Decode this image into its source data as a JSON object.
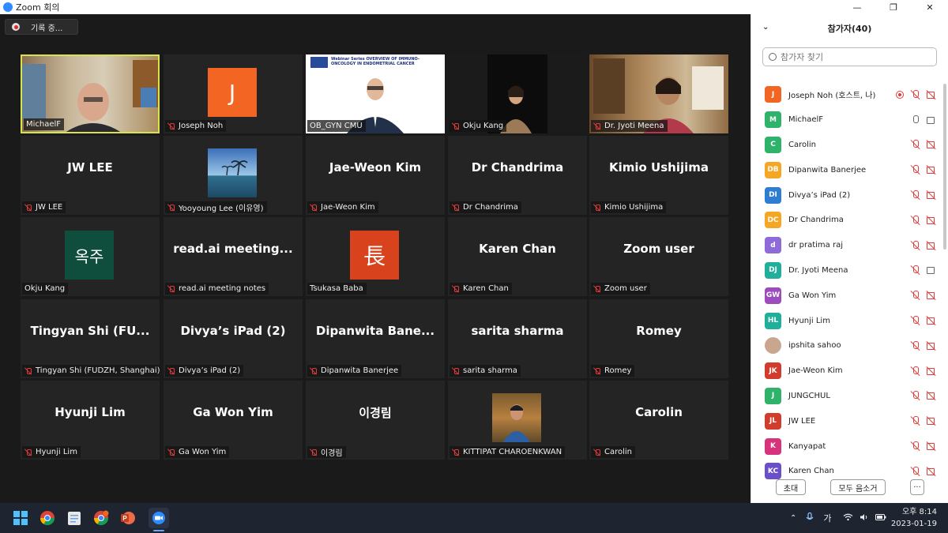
{
  "window": {
    "title": "Zoom 회의",
    "minimize": "—",
    "restore": "❐",
    "close": "✕"
  },
  "recording": {
    "label": "기록 중..."
  },
  "grid": [
    {
      "label": "MichaelF",
      "big": "",
      "kind": "video-michael",
      "active": true,
      "mic_off": false
    },
    {
      "label": "Joseph Noh",
      "big": "J",
      "kind": "avatar",
      "color": "#f26522",
      "mic_off": true
    },
    {
      "label": "OB_GYN CMU",
      "big": "",
      "kind": "video-obgyn",
      "mic_off": false,
      "slide_text": "Webinar Series  OVERVIEW OF IMMUNO-ONCOLOGY IN ENDOMETRIAL CANCER"
    },
    {
      "label": "Okju Kang",
      "big": "",
      "kind": "video-dark",
      "mic_off": true
    },
    {
      "label": "Dr. Jyoti Meena",
      "big": "",
      "kind": "video-jyoti",
      "mic_off": true
    },
    {
      "label": "JW LEE",
      "big": "JW LEE",
      "kind": "name",
      "mic_off": true
    },
    {
      "label": "Yooyoung Lee (이유영)",
      "big": "",
      "kind": "photo-sea",
      "mic_off": true
    },
    {
      "label": "Jae-Weon Kim",
      "big": "Jae-Weon Kim",
      "kind": "name",
      "mic_off": true
    },
    {
      "label": "Dr Chandrima",
      "big": "Dr Chandrima",
      "kind": "name",
      "mic_off": true
    },
    {
      "label": "Kimio Ushijima",
      "big": "Kimio Ushijima",
      "kind": "name",
      "mic_off": true
    },
    {
      "label": "Okju Kang",
      "big": "옥주",
      "kind": "avatar",
      "color": "#0f4d3c",
      "mic_off": false
    },
    {
      "label": "read.ai meeting notes",
      "big": "read.ai meeting...",
      "kind": "name",
      "mic_off": true
    },
    {
      "label": "Tsukasa Baba",
      "big": "長",
      "kind": "avatar",
      "color": "#d8431d",
      "mic_off": false
    },
    {
      "label": "Karen Chan",
      "big": "Karen Chan",
      "kind": "name",
      "mic_off": true
    },
    {
      "label": "Zoom user",
      "big": "Zoom user",
      "kind": "name",
      "mic_off": true
    },
    {
      "label": "Tingyan Shi (FUDZH, Shanghai)",
      "big": "Tingyan Shi (FU...",
      "kind": "name",
      "mic_off": true
    },
    {
      "label": "Divya’s iPad (2)",
      "big": "Divya’s iPad (2)",
      "kind": "name",
      "mic_off": true
    },
    {
      "label": "Dipanwita Banerjee",
      "big": "Dipanwita Bane...",
      "kind": "name",
      "mic_off": true
    },
    {
      "label": "sarita sharma",
      "big": "sarita sharma",
      "kind": "name",
      "mic_off": true
    },
    {
      "label": "Romey",
      "big": "Romey",
      "kind": "name",
      "mic_off": true
    },
    {
      "label": "Hyunji Lim",
      "big": "Hyunji Lim",
      "kind": "name",
      "mic_off": true
    },
    {
      "label": "Ga Won Yim",
      "big": "Ga Won Yim",
      "kind": "name",
      "mic_off": true
    },
    {
      "label": "이경림",
      "big": "이경림",
      "kind": "name",
      "mic_off": true
    },
    {
      "label": "KITTIPAT CHAROENKWAN",
      "big": "",
      "kind": "photo-person",
      "mic_off": true
    },
    {
      "label": "Carolin",
      "big": "Carolin",
      "kind": "name",
      "mic_off": true
    }
  ],
  "panel": {
    "title": "참가자(40)",
    "search_placeholder": "참가자 찾기",
    "participants": [
      {
        "initials": "J",
        "name": "Joseph Noh (호스트, 나)",
        "color": "#f26522",
        "rec": true,
        "mic": "off",
        "cam": "off"
      },
      {
        "initials": "M",
        "name": "MichaelF",
        "color": "#2fb36b",
        "rec": false,
        "mic": "on",
        "cam": "on"
      },
      {
        "initials": "C",
        "name": "Carolin",
        "color": "#2fb36b",
        "rec": false,
        "mic": "off",
        "cam": "off"
      },
      {
        "initials": "DB",
        "name": "Dipanwita Banerjee",
        "color": "#f5a623",
        "rec": false,
        "mic": "off",
        "cam": "off"
      },
      {
        "initials": "DI",
        "name": "Divya’s iPad (2)",
        "color": "#2d7dd2",
        "rec": false,
        "mic": "off",
        "cam": "off"
      },
      {
        "initials": "DC",
        "name": "Dr Chandrima",
        "color": "#f5a623",
        "rec": false,
        "mic": "off",
        "cam": "off"
      },
      {
        "initials": "d",
        "name": "dr pratima raj",
        "color": "#8e6bd8",
        "rec": false,
        "mic": "off",
        "cam": "off"
      },
      {
        "initials": "DJ",
        "name": "Dr. Jyoti Meena",
        "color": "#1faf9a",
        "rec": false,
        "mic": "off",
        "cam": "on"
      },
      {
        "initials": "GW",
        "name": "Ga Won Yim",
        "color": "#9b4dbd",
        "rec": false,
        "mic": "off",
        "cam": "off"
      },
      {
        "initials": "HL",
        "name": "Hyunji Lim",
        "color": "#1faf9a",
        "rec": false,
        "mic": "off",
        "cam": "off"
      },
      {
        "initials": "",
        "name": "ipshita sahoo",
        "color": "#c9a690",
        "rec": false,
        "mic": "off",
        "cam": "off"
      },
      {
        "initials": "JK",
        "name": "Jae-Weon Kim",
        "color": "#d23c2d",
        "rec": false,
        "mic": "off",
        "cam": "off"
      },
      {
        "initials": "J",
        "name": "JUNGCHUL",
        "color": "#2fb36b",
        "rec": false,
        "mic": "off",
        "cam": "off"
      },
      {
        "initials": "JL",
        "name": "JW LEE",
        "color": "#d23c2d",
        "rec": false,
        "mic": "off",
        "cam": "off"
      },
      {
        "initials": "K",
        "name": "Kanyapat",
        "color": "#d6337a",
        "rec": false,
        "mic": "off",
        "cam": "off"
      },
      {
        "initials": "KC",
        "name": "Karen Chan",
        "color": "#6a4fc9",
        "rec": false,
        "mic": "off",
        "cam": "off"
      }
    ],
    "invite_label": "초대",
    "mute_all_label": "모두 음소거",
    "more_label": "···"
  },
  "taskbar": {
    "tray_lang": "가",
    "time": "오후 8:14",
    "date": "2023-01-19",
    "apps": [
      "windows-start",
      "chrome",
      "notepad",
      "chrome-alt",
      "powerpoint",
      "zoom"
    ]
  }
}
